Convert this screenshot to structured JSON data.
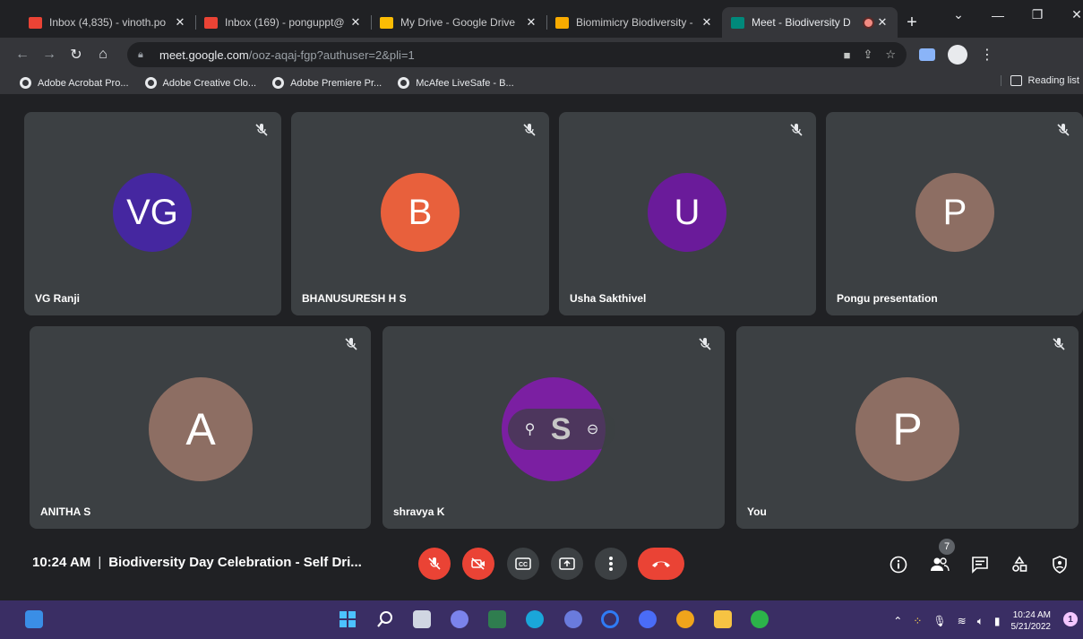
{
  "browser": {
    "tabs": [
      {
        "title": "Inbox (4,835) - vinoth.po",
        "favicon_color": "#ea4335",
        "active": false
      },
      {
        "title": "Inbox (169) - ponguppt@",
        "favicon_color": "#ea4335",
        "active": false
      },
      {
        "title": "My Drive - Google Drive",
        "favicon_color": "#fbbc04",
        "active": false
      },
      {
        "title": "Biomimicry Biodiversity -",
        "favicon_color": "#f9ab00",
        "active": false
      },
      {
        "title": "Meet - Biodiversity D",
        "favicon_color": "#00897b",
        "active": true
      }
    ],
    "new_tab_label": "+",
    "url_host": "meet.google.com",
    "url_path": "/ooz-aqaj-fgp?authuser=2&pli=1",
    "bookmarks": [
      "Adobe Acrobat Pro...",
      "Adobe Creative Clo...",
      "Adobe Premiere Pr...",
      "McAfee LiveSafe - B..."
    ],
    "reading_list_label": "Reading list"
  },
  "meet": {
    "participants_row1": [
      {
        "name": "VG Ranji",
        "initials": "VG",
        "color": "#4527a0"
      },
      {
        "name": "BHANUSURESH H S",
        "initials": "B",
        "color": "#e8603c"
      },
      {
        "name": "Usha Sakthivel",
        "initials": "U",
        "color": "#6a1b9a"
      },
      {
        "name": "Pongu presentation",
        "initials": "P",
        "color": "#8d6e63"
      }
    ],
    "participants_row2": [
      {
        "name": "ANITHA S",
        "initials": "A",
        "color": "#8d6e63"
      },
      {
        "name": "shravya K",
        "initials": "S",
        "color": "#7b1fa2"
      },
      {
        "name": "You",
        "initials": "P",
        "color": "#8d6e63"
      }
    ],
    "time": "10:24 AM",
    "separator": "|",
    "meeting_title": "Biodiversity Day Celebration - Self Dri...",
    "participant_count": "7"
  },
  "taskbar": {
    "clock_time": "10:24 AM",
    "clock_date": "5/21/2022",
    "notification_count": "1",
    "accent": "#3a2e64"
  }
}
